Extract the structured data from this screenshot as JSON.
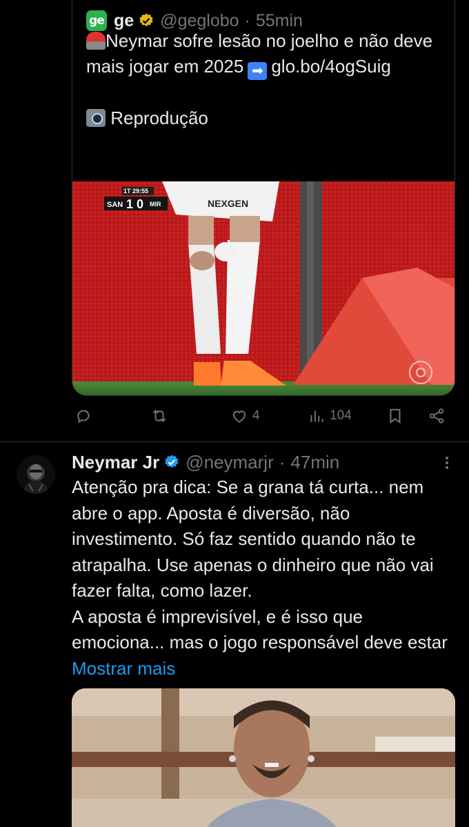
{
  "quoted_tweet": {
    "logo_text": "ge",
    "name": "ge",
    "handle": "@geglobo",
    "separator": "·",
    "time": "55min",
    "text_line1": "Neymar sofre lesão no joelho e não deve mais jogar em 2025",
    "link_text": "glo.bo/4ogSuig",
    "credit": "Reprodução",
    "media": {
      "scorebug_time": "1T 29:55",
      "home_team": "SAN",
      "home_score": "1",
      "away_score": "0",
      "away_team": "MIR",
      "sponsor": "NEXGEN"
    }
  },
  "actions": {
    "reply_count": "",
    "retweet_count": "",
    "like_count": "4",
    "views_count": "104"
  },
  "tweet": {
    "name": "Neymar Jr",
    "handle": "@neymarjr",
    "separator": "·",
    "time": "47min",
    "text": "Atenção pra dica: Se a grana tá curta... nem abre o app. Aposta é diversão, não investimento. Só faz sentido quando não te atrapalha. Use apenas o dinheiro que não vai fazer falta, como lazer.",
    "text2": "A aposta é imprevisível, e é isso que emociona... mas o jogo responsável deve estar",
    "show_more": "Mostrar mais"
  },
  "colors": {
    "accent": "#1d9bf0",
    "muted": "#71767b",
    "text": "#e7e9ea",
    "background": "#000000",
    "ge_green": "#2bb24c",
    "gold_badge": "#e2b719"
  }
}
